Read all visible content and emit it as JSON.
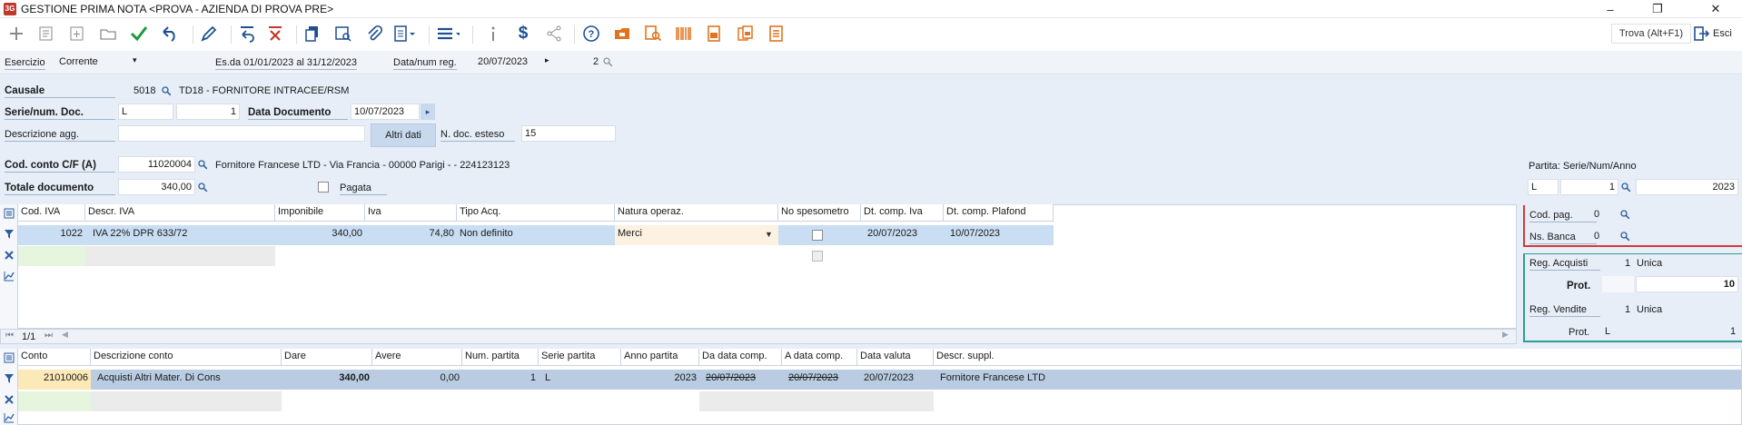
{
  "window": {
    "title": "GESTIONE PRIMA NOTA <PROVA - AZIENDA DI PROVA PRE>",
    "logo": "3G",
    "min": "–",
    "restore": "❐",
    "close": "✕"
  },
  "toolbar": {
    "trova": "Trova (Alt+F1)",
    "esci": "Esci"
  },
  "esercizio": {
    "label": "Esercizio",
    "value": "Corrente",
    "range": "Es.da 01/01/2023 al 31/12/2023",
    "data_label": "Data/num reg.",
    "data_value": "20/07/2023",
    "num_value": "2"
  },
  "form": {
    "causale_label": "Causale",
    "causale_code": "5018",
    "causale_desc": "TD18 - FORNITORE INTRACEE/RSM",
    "serie_label": "Serie/num. Doc.",
    "serie_value": "L",
    "num_doc": "1",
    "data_doc_label": "Data Documento",
    "data_doc_value": "10/07/2023",
    "descr_agg_label": "Descrizione agg.",
    "altri_dati": "Altri dati",
    "ndoc_esteso_label": "N. doc. esteso",
    "ndoc_esteso_value": "15",
    "codconto_label": "Cod. conto C/F  (A)",
    "codconto_value": "11020004",
    "codconto_desc": "Fornitore Francese LTD  - Via Francia - 00000 Parigi  -  - 224123123",
    "totale_label": "Totale documento",
    "totale_value": "340,00",
    "pagata_label": "Pagata"
  },
  "partita": {
    "label": "Partita: Serie/Num/Anno",
    "serie": "L",
    "num": "1",
    "anno": "2023"
  },
  "codpag": {
    "label": "Cod. pag.",
    "value": "0"
  },
  "nsbanca": {
    "label": "Ns. Banca",
    "value": "0"
  },
  "regs": {
    "acq_label": "Reg. Acquisti",
    "acq_num": "1",
    "acq_type": "Unica",
    "prot_label": "Prot.",
    "prot_value": "10",
    "ven_label": "Reg. Vendite",
    "ven_num": "1",
    "ven_type": "Unica",
    "prot2_label": "Prot.",
    "prot2_serie": "L",
    "prot2_value": "1"
  },
  "iva_grid": {
    "headers": [
      "Cod. IVA",
      "Descr. IVA",
      "Imponibile",
      "Iva",
      "Tipo Acq.",
      "Natura operaz.",
      "No spesometro",
      "Dt. comp. Iva",
      "Dt. comp. Plafond"
    ],
    "row": [
      "1022",
      "IVA 22% DPR 633/72",
      "340,00",
      "74,80",
      "Non definito",
      "Merci",
      "",
      "20/07/2023",
      "10/07/2023"
    ],
    "pager": "1/1"
  },
  "conti_grid": {
    "headers": [
      "Conto",
      "Descrizione conto",
      "Dare",
      "Avere",
      "Num. partita",
      "Serie partita",
      "Anno partita",
      "Da data comp.",
      "A data comp.",
      "Data valuta",
      "Descr. suppl."
    ],
    "row": [
      "21010006",
      "Acquisti Altri Mater. Di Cons",
      "340,00",
      "0,00",
      "1",
      "L",
      "2023",
      "20/07/2023",
      "20/07/2023",
      "20/07/2023",
      "Fornitore Francese LTD"
    ]
  }
}
